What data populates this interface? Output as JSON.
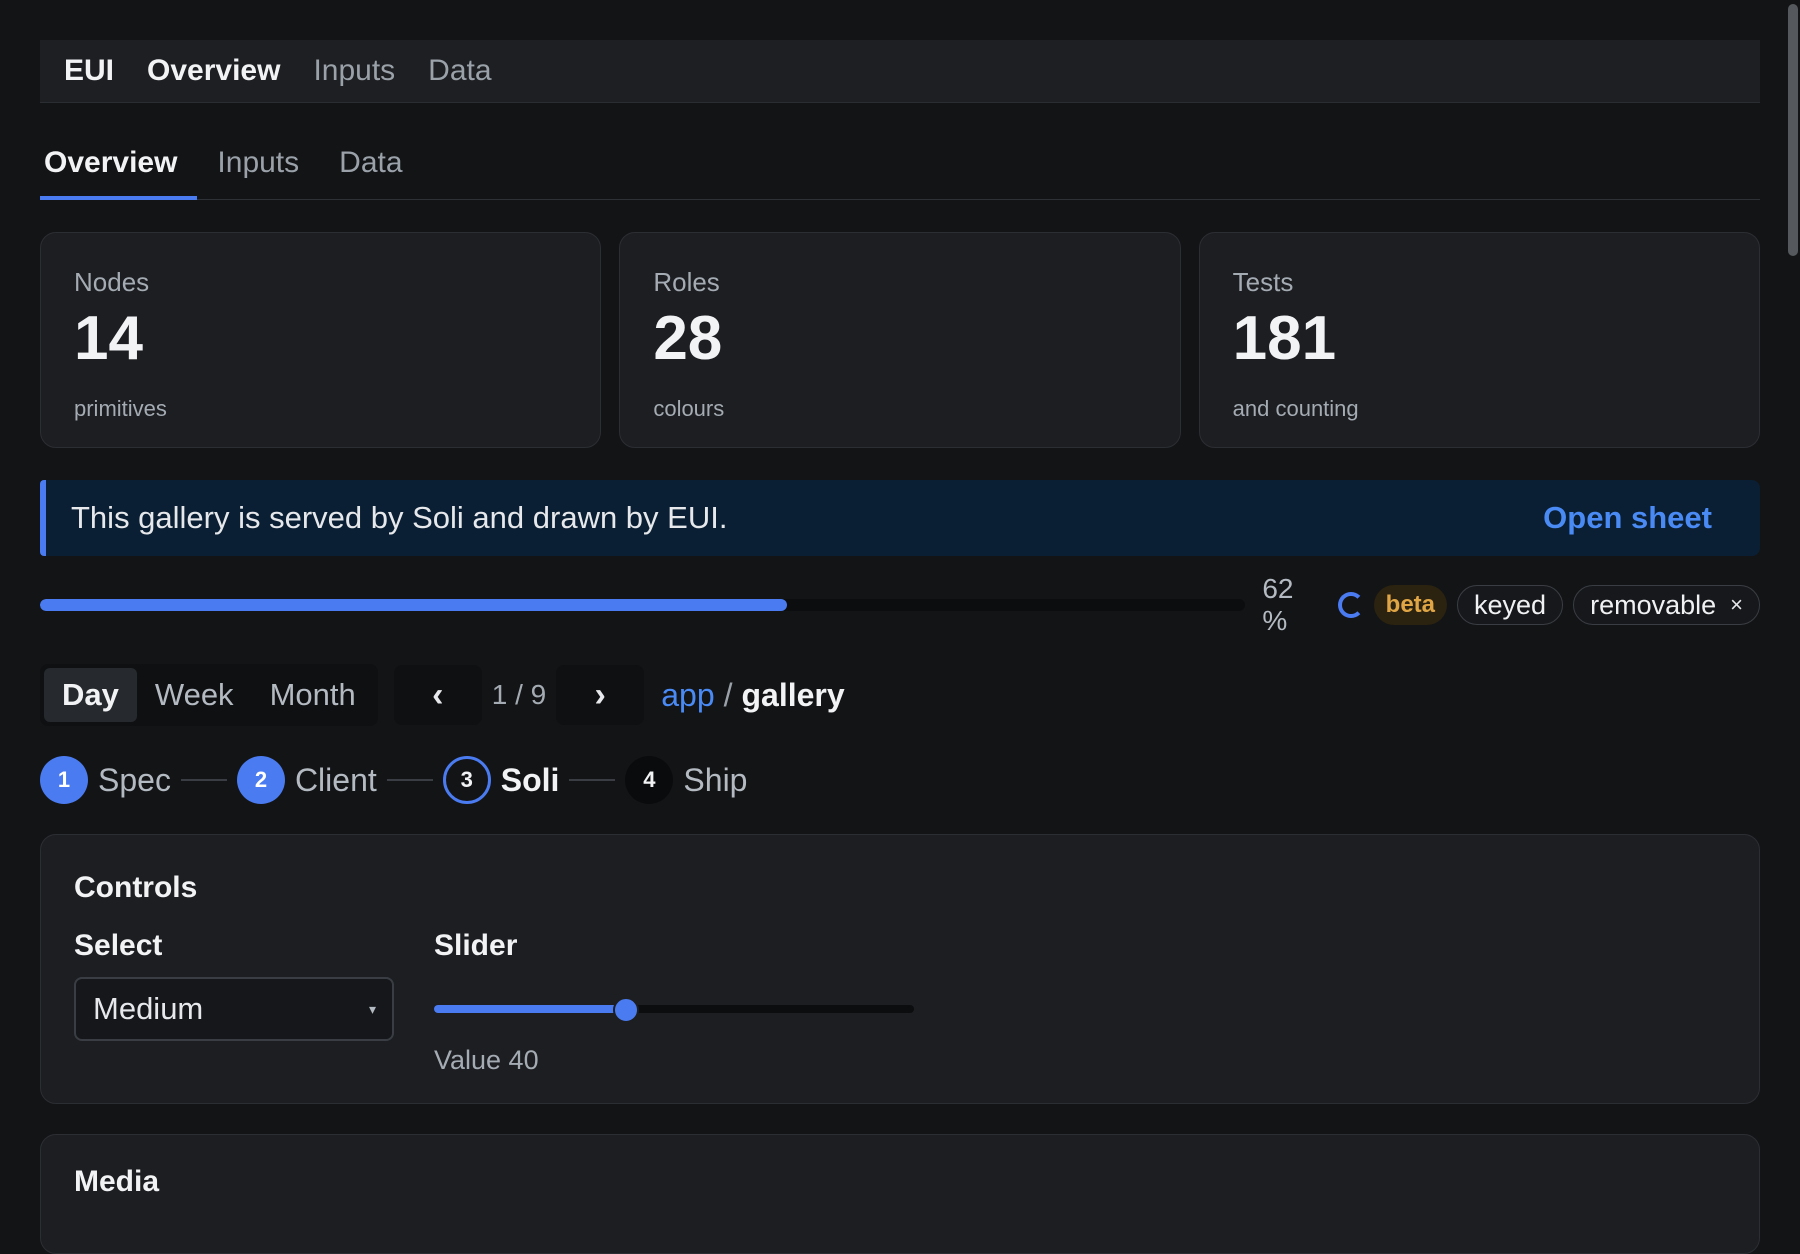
{
  "topbar": {
    "brand": "EUI",
    "nav": [
      "Overview",
      "Inputs",
      "Data"
    ]
  },
  "tabs": [
    "Overview",
    "Inputs",
    "Data"
  ],
  "cards": [
    {
      "label": "Nodes",
      "value": "14",
      "sub": "primitives"
    },
    {
      "label": "Roles",
      "value": "28",
      "sub": "colours"
    },
    {
      "label": "Tests",
      "value": "181",
      "sub": "and counting"
    }
  ],
  "banner": {
    "message": "This gallery is served by Soli and drawn by EUI.",
    "action": "Open sheet"
  },
  "progress": {
    "value": 0.62,
    "label": "62 %",
    "chips": {
      "beta": "beta",
      "keyed": "keyed",
      "removable": "removable",
      "remove_glyph": "×"
    }
  },
  "segmented": {
    "options": [
      "Day",
      "Week",
      "Month"
    ],
    "selected": "Day"
  },
  "pager": {
    "prev": "‹",
    "next": "›",
    "count": "1 / 9"
  },
  "breadcrumb": {
    "link": "app",
    "separator": "/",
    "current": "gallery"
  },
  "stepper": [
    {
      "num": "1",
      "label": "Spec",
      "state": "done"
    },
    {
      "num": "2",
      "label": "Client",
      "state": "done"
    },
    {
      "num": "3",
      "label": "Soli",
      "state": "current"
    },
    {
      "num": "4",
      "label": "Ship",
      "state": "todo"
    }
  ],
  "controls": {
    "title": "Controls",
    "select": {
      "label": "Select",
      "value": "Medium",
      "caret": "▾"
    },
    "slider": {
      "label": "Slider",
      "value": 40,
      "value_text": "Value 40"
    }
  },
  "media": {
    "title": "Media"
  },
  "colors": {
    "accent": "#4a7bf0",
    "link": "#4a8af5",
    "warning": "#e0a545",
    "bg": "#131416",
    "surface": "#1c1e21"
  }
}
